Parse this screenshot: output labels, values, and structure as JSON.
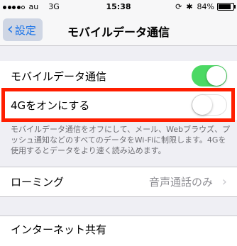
{
  "status_bar": {
    "carrier": "au",
    "network": "3G",
    "time": "15:38",
    "battery": "84%",
    "battery_level": 0.84
  },
  "nav": {
    "back_label": "設定",
    "title": "モバイルデータ通信"
  },
  "cells": {
    "mobile_data": {
      "label": "モバイルデータ通信",
      "on": true
    },
    "lte": {
      "label": "4Gをオンにする",
      "on": false
    },
    "roaming": {
      "label": "ローミング",
      "value": "音声通話のみ"
    },
    "hotspot": {
      "label": "インターネット共有"
    }
  },
  "note": "モバイルデータ通信をオフにして、メール、Webブラウズ、プッシュ通知などのすべてのデータをWi-Fiに制限します。4Gを使用するとデータをより速く読み込めます。",
  "colors": {
    "toggle_on": "#4cd964",
    "highlight": "#ff1e00",
    "accent": "#1a73e8"
  }
}
